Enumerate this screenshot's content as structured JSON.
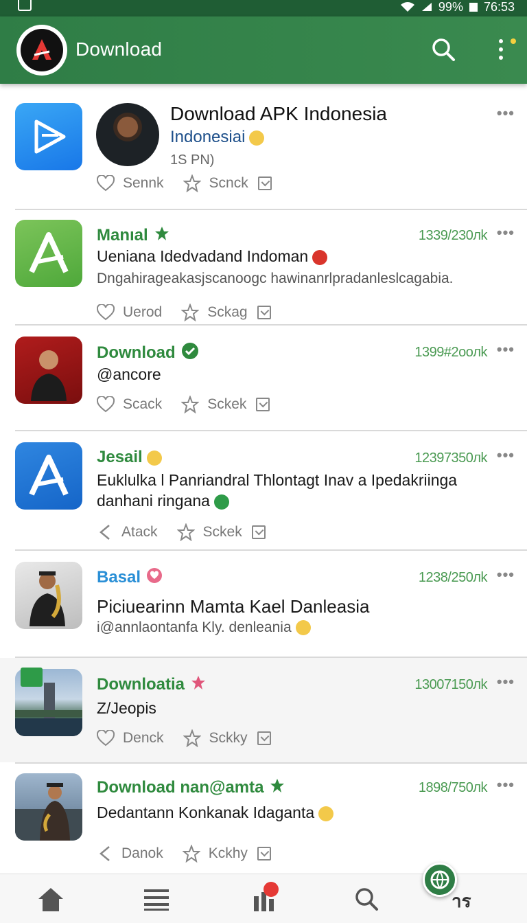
{
  "status_bar": {
    "battery": "99%",
    "time": "76:53"
  },
  "app_bar": {
    "title": "Download"
  },
  "items": [
    {
      "title": "Download APK Indonesia",
      "subtitle": "Indonesiai",
      "time": "1S PN)",
      "actions": [
        "Sennk",
        "Scnck"
      ]
    },
    {
      "name": "Manıal",
      "meta": "1339/230лk",
      "line1": "Ueniana Idedvadand Indoman",
      "line2": "Dngahirageakasjscanoogc hawinanrlpradanleslcagabia.",
      "actions": [
        "Uerod",
        "Sckag"
      ]
    },
    {
      "name": "Download",
      "meta": "1399#2ooлk",
      "line1": "@ancore",
      "actions": [
        "Scack",
        "Sckek"
      ]
    },
    {
      "name": "Jesail",
      "meta": "12397350лk",
      "line1": "Euklulka l Panriandral Thlontagt Inav a Ipedakriinga",
      "line2": "danhani ringana",
      "actions": [
        "Atack",
        "Sckek"
      ]
    },
    {
      "name": "Basal",
      "meta": "1238/250лk",
      "line1": "Piciuearinn Mamta Kael Danleasia",
      "line2": "i@annlaontanfa Kly. denleania"
    },
    {
      "name": "Downloatia",
      "meta": "13007150лk",
      "line1": "Z/Jeopis",
      "actions": [
        "Denck",
        "Sckky"
      ]
    },
    {
      "name": "Download nan@amta",
      "meta": "1898/750лk",
      "line1": "Dedantann Konkanak Idaganta",
      "actions": [
        "Danok",
        "Kckhy"
      ]
    }
  ],
  "bottom_nav": {
    "fab_label": "าร"
  },
  "colors": {
    "primary": "#2f7d46",
    "accent_green": "#2f8a3e",
    "accent_blue": "#2a8fd6"
  }
}
